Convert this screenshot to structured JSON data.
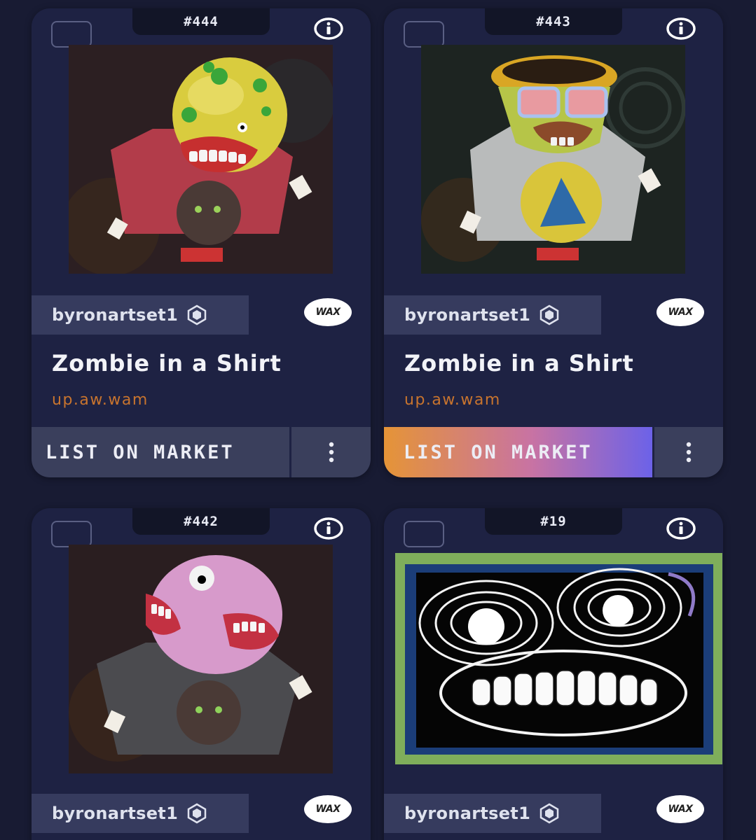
{
  "cards": [
    {
      "number": "#444",
      "collection": "byronartset1",
      "chain_badge": "WAX",
      "title": "Zombie in a Shirt",
      "mint_account": "up.aw.wam",
      "list_label": "LIST ON MARKET",
      "more_icon": "vertical-dots-icon",
      "list_button_style": "default"
    },
    {
      "number": "#443",
      "collection": "byronartset1",
      "chain_badge": "WAX",
      "title": "Zombie in a Shirt",
      "mint_account": "up.aw.wam",
      "list_label": "LIST ON MARKET",
      "more_icon": "vertical-dots-icon",
      "list_button_style": "gradient"
    },
    {
      "number": "#442",
      "collection": "byronartset1",
      "chain_badge": "WAX"
    },
    {
      "number": "#19",
      "collection": "byronartset1",
      "chain_badge": "WAX"
    }
  ],
  "colors": {
    "background": "#181b33",
    "card": "#1e2243",
    "accent_orange": "#c8742e",
    "gradient_start": "#e59437",
    "gradient_end": "#6c62e8"
  }
}
